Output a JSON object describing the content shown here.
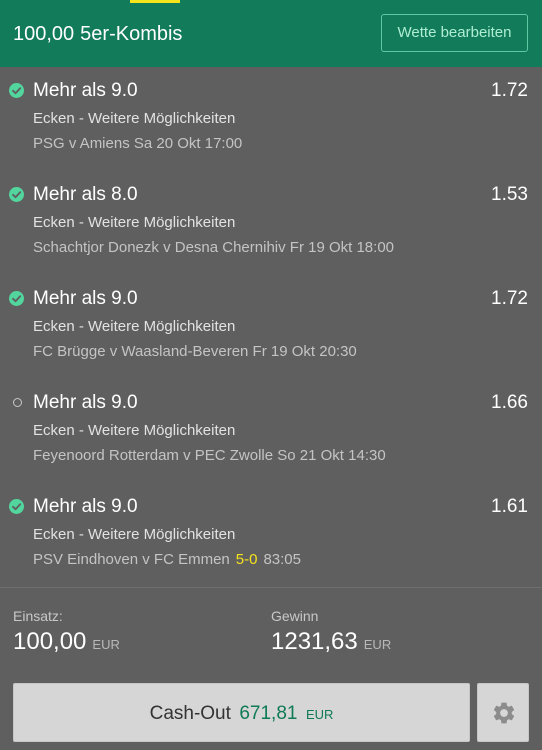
{
  "header": {
    "stake": "100,00",
    "bet_type": "5er-Kombis",
    "edit_button": "Wette bearbeiten"
  },
  "colors": {
    "header_bg": "#127b59",
    "accent_yellow": "#f5e31b",
    "won_green": "#52d69d",
    "body_bg": "#5f5f5f",
    "cashout_green": "#0f7a56"
  },
  "bets": [
    {
      "status": "won",
      "status_icon": "check-circle-icon",
      "selection": "Mehr als 9.0",
      "odds": "1.72",
      "market": "Ecken - Weitere Möglichkeiten",
      "event": "PSG v Amiens Sa 20 Okt 17:00"
    },
    {
      "status": "won",
      "status_icon": "check-circle-icon",
      "selection": "Mehr als 8.0",
      "odds": "1.53",
      "market": "Ecken - Weitere Möglichkeiten",
      "event": "Schachtjor Donezk v Desna Chernihiv Fr 19 Okt 18:00"
    },
    {
      "status": "won",
      "status_icon": "check-circle-icon",
      "selection": "Mehr als 9.0",
      "odds": "1.72",
      "market": "Ecken - Weitere Möglichkeiten",
      "event": "FC Brügge v Waasland-Beveren Fr 19 Okt 20:30"
    },
    {
      "status": "open",
      "status_icon": "open-circle-icon",
      "selection": "Mehr als 9.0",
      "odds": "1.66",
      "market": "Ecken - Weitere Möglichkeiten",
      "event": "Feyenoord Rotterdam v PEC Zwolle So 21 Okt 14:30"
    },
    {
      "status": "won",
      "status_icon": "check-circle-icon",
      "selection": "Mehr als 9.0",
      "odds": "1.61",
      "market": "Ecken - Weitere Möglichkeiten",
      "event": "PSV Eindhoven v FC Emmen",
      "score": "5-0",
      "clock": "83:05"
    }
  ],
  "summary": {
    "stake_label": "Einsatz:",
    "stake_value": "100,00",
    "stake_currency": "EUR",
    "return_label": "Gewinn",
    "return_value": "1231,63",
    "return_currency": "EUR"
  },
  "cashout": {
    "label": "Cash-Out",
    "amount": "671,81",
    "currency": "EUR",
    "settings_icon": "gear-icon"
  }
}
